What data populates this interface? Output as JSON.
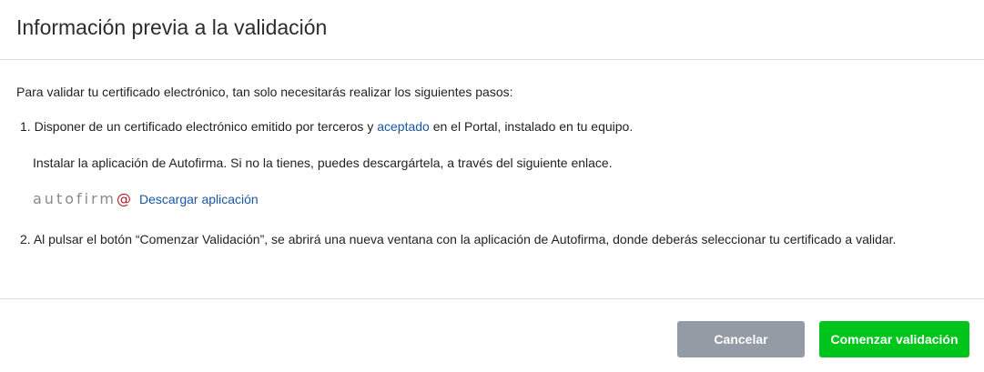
{
  "dialog": {
    "title": "Información previa a la validación"
  },
  "body": {
    "intro": "Para validar tu certificado electrónico, tan solo necesitarás realizar los siguientes pasos:",
    "step1": {
      "number": "1.",
      "text_before": "Disponer de un certificado electrónico emitido por terceros y",
      "link": "aceptado",
      "text_after": "en el Portal, instalado en tu equipo."
    },
    "install_text": "Instalar la aplicación de Autofirma. Si no la tienes, puedes descargártela, a través del siguiente enlace.",
    "autofirma": {
      "logo_text": "autofirm",
      "logo_accent": "@",
      "download_link": "Descargar aplicación"
    },
    "step2": {
      "number": "2.",
      "text": "Al pulsar el botón “Comenzar Validación”, se abrirá una nueva ventana con la aplicación de Autofirma, donde deberás seleccionar tu certificado a validar."
    }
  },
  "footer": {
    "cancel_label": "Cancelar",
    "start_label": "Comenzar validación"
  },
  "colors": {
    "link": "#1a56a0",
    "cancel_button": "#939ba4",
    "start_button": "#00c51c",
    "logo_accent": "#b3212c"
  }
}
